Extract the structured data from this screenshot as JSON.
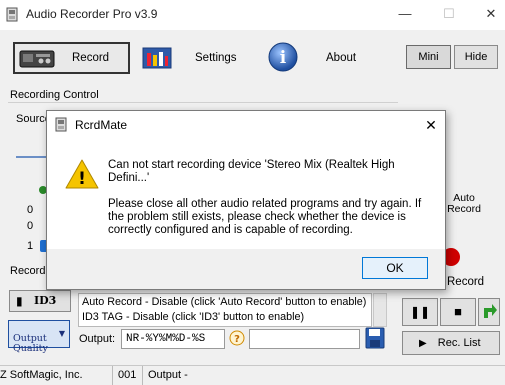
{
  "app": {
    "title": "Audio Recorder Pro v3.9",
    "window_controls": {
      "minimize": "—",
      "maximize": "☐",
      "close": "✕"
    }
  },
  "toolbar": {
    "record_label": "Record",
    "settings_label": "Settings",
    "about_label": "About",
    "mini_label": "Mini",
    "hide_label": "Hide",
    "about_icon_glyph": "i"
  },
  "recording_control": {
    "group_label": "Recording Control",
    "source_label": "Source",
    "level_ticks": [
      "0",
      "0",
      "1"
    ],
    "auto_record_label": "Auto\nRecord",
    "record_button_label": "Record"
  },
  "recording_options": {
    "group_label": "Recordi",
    "id3_label": "ID3",
    "output_quality_label": "Output\nQuality",
    "auto_record_text": "Auto Record - Disable (click 'Auto Record' button to enable)",
    "id3_tag_text": "ID3 TAG - Disable (click 'ID3' button to enable)",
    "output_label": "Output:",
    "output_value": "NR-%Y%M%D-%S",
    "help_glyph": "?"
  },
  "transport": {
    "pause_glyph": "❚❚",
    "stop_glyph": "■",
    "rec_list_label": "Rec. List",
    "rec_list_glyph": "▶"
  },
  "status_bar": {
    "company": "Z SoftMagic, Inc.",
    "count": "001",
    "output": "Output -"
  },
  "dialog": {
    "title": "RcrdMate",
    "close_glyph": "✕",
    "line1": "Can not start recording device 'Stereo Mix (Realtek High",
    "line2": "Defini...'",
    "line3": "Please close all other audio related programs and try again. If",
    "line4": "the problem still exists, please check whether the device is",
    "line5": "correctly configured and is capable of recording.",
    "ok_label": "OK",
    "warning_glyph": "!"
  },
  "colors": {
    "accent": "#0078d7",
    "warning": "#f5c400",
    "record_red": "#d00000",
    "save_blue": "#2a5db0",
    "arrow_green": "#2a9a2a"
  }
}
